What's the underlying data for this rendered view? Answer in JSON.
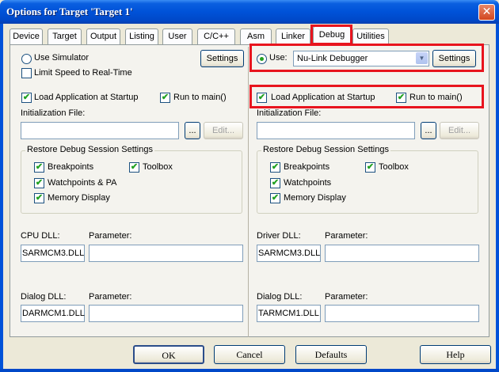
{
  "window": {
    "title": "Options for Target 'Target 1'"
  },
  "tabs": [
    {
      "label": "Device"
    },
    {
      "label": "Target"
    },
    {
      "label": "Output"
    },
    {
      "label": "Listing"
    },
    {
      "label": "User"
    },
    {
      "label": "C/C++"
    },
    {
      "label": "Asm"
    },
    {
      "label": "Linker"
    },
    {
      "label": "Debug"
    },
    {
      "label": "Utilities"
    }
  ],
  "left": {
    "use_simulator": "Use Simulator",
    "limit_speed": "Limit Speed to Real-Time",
    "settings_label": "Settings",
    "load_app": "Load Application at Startup",
    "run_to_main": "Run to main()",
    "init_file_label": "Initialization File:",
    "browse_label": "...",
    "edit_label": "Edit...",
    "restore_group": "Restore Debug Session Settings",
    "breakpoints": "Breakpoints",
    "toolbox": "Toolbox",
    "watchpoints": "Watchpoints & PA",
    "memory_display": "Memory Display",
    "cpu_dll_label": "CPU DLL:",
    "cpu_dll_value": "SARMCM3.DLL",
    "parameter_label": "Parameter:",
    "dialog_dll_label": "Dialog DLL:",
    "dialog_dll_value": "DARMCM1.DLL"
  },
  "right": {
    "use_label": "Use:",
    "debugger": "Nu-Link Debugger",
    "settings_label": "Settings",
    "load_app": "Load Application at Startup",
    "run_to_main": "Run to main()",
    "init_file_label": "Initialization File:",
    "browse_label": "...",
    "edit_label": "Edit...",
    "restore_group": "Restore Debug Session Settings",
    "breakpoints": "Breakpoints",
    "toolbox": "Toolbox",
    "watchpoints": "Watchpoints",
    "memory_display": "Memory Display",
    "driver_dll_label": "Driver DLL:",
    "driver_dll_value": "SARMCM3.DLL",
    "parameter_label": "Parameter:",
    "dialog_dll_label": "Dialog DLL:",
    "dialog_dll_value": "TARMCM1.DLL"
  },
  "footer": {
    "ok": "OK",
    "cancel": "Cancel",
    "defaults": "Defaults",
    "help": "Help"
  },
  "colors": {
    "highlight": "#e8141e",
    "check": "#21a121",
    "titlebar": "#0052d8"
  }
}
